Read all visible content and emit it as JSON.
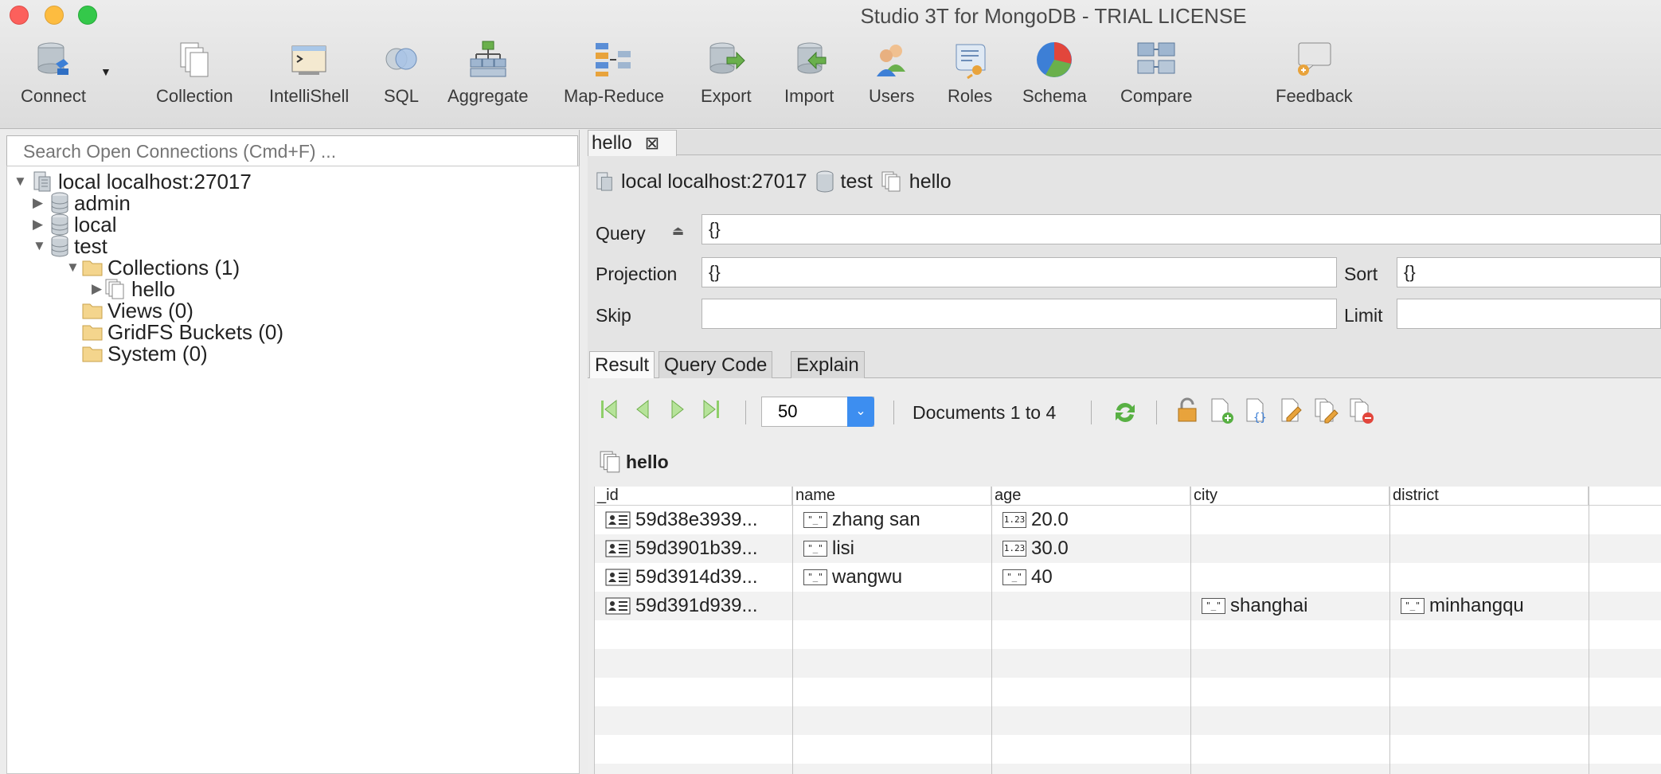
{
  "window": {
    "title": "Studio 3T for MongoDB - TRIAL LICENSE"
  },
  "toolbar": {
    "items": [
      {
        "label": "Connect",
        "icon": "connect-icon"
      },
      {
        "label": "Collection",
        "icon": "collection-icon"
      },
      {
        "label": "IntelliShell",
        "icon": "intellishell-icon"
      },
      {
        "label": "SQL",
        "icon": "sql-icon"
      },
      {
        "label": "Aggregate",
        "icon": "aggregate-icon"
      },
      {
        "label": "Map-Reduce",
        "icon": "map-reduce-icon"
      },
      {
        "label": "Export",
        "icon": "export-icon"
      },
      {
        "label": "Import",
        "icon": "import-icon"
      },
      {
        "label": "Users",
        "icon": "users-icon"
      },
      {
        "label": "Roles",
        "icon": "roles-icon"
      },
      {
        "label": "Schema",
        "icon": "schema-icon"
      },
      {
        "label": "Compare",
        "icon": "compare-icon"
      },
      {
        "label": "Feedback",
        "icon": "feedback-icon"
      }
    ]
  },
  "sidebar": {
    "search_placeholder": "Search Open Connections (Cmd+F) ...",
    "tree": {
      "connection": "local localhost:27017",
      "db_admin": "admin",
      "db_local": "local",
      "db_test": "test",
      "collections": "Collections (1)",
      "coll_hello": "hello",
      "views": "Views (0)",
      "gridfs": "GridFS Buckets (0)",
      "system": "System (0)"
    }
  },
  "tab": {
    "label": "hello"
  },
  "breadcrumb": {
    "connection": "local localhost:27017",
    "database": "test",
    "collection": "hello"
  },
  "query": {
    "query_label": "Query",
    "query_value": "{}",
    "projection_label": "Projection",
    "projection_value": "{}",
    "sort_label": "Sort",
    "sort_value": "{}",
    "skip_label": "Skip",
    "skip_value": "",
    "limit_label": "Limit",
    "limit_value": ""
  },
  "result_tabs": {
    "result": "Result",
    "query_code": "Query Code",
    "explain": "Explain"
  },
  "pager": {
    "page_size": "50",
    "documents_label": "Documents 1 to 4"
  },
  "grid": {
    "collection_name": "hello",
    "columns": {
      "id": "_id",
      "name": "name",
      "age": "age",
      "city": "city",
      "district": "district"
    },
    "rows": [
      {
        "id": "59d38e3939...",
        "name": "zhang san",
        "age": "20.0",
        "city": "",
        "district": ""
      },
      {
        "id": "59d3901b39...",
        "name": "lisi",
        "age": "30.0",
        "city": "",
        "district": ""
      },
      {
        "id": "59d3914d39...",
        "name": "wangwu",
        "age": "40",
        "city": "",
        "district": ""
      },
      {
        "id": "59d391d939...",
        "name": "",
        "age": "",
        "city": "shanghai",
        "district": "minhangqu"
      }
    ],
    "type_badges": {
      "number": "1.23",
      "string": "\"_\""
    }
  },
  "colors": {
    "accent": "#3d8ef0",
    "close": "#fc605c",
    "minimize": "#fdbc40",
    "maximize": "#34c84a"
  }
}
